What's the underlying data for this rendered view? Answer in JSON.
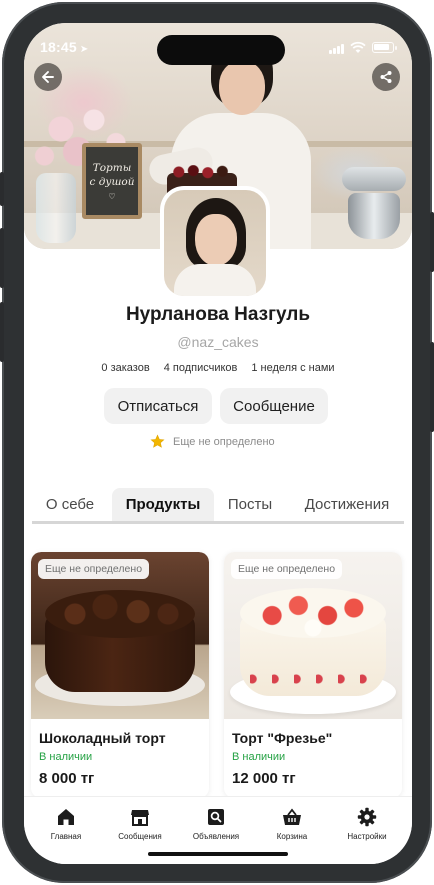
{
  "status": {
    "time": "18:45"
  },
  "hero": {
    "chalkboard_line1": "Торты",
    "chalkboard_line2": "с душой",
    "chalkboard_heart": "♡"
  },
  "profile": {
    "name": "Нурланова Назгуль",
    "handle": "@naz_cakes",
    "stats": {
      "orders": "0 заказов",
      "followers": "4 подписчиков",
      "since": "1 неделя с нами"
    },
    "unsubscribe_label": "Отписаться",
    "message_label": "Сообщение",
    "rating_text": "Еще не определено"
  },
  "tabs": [
    {
      "label": "О себе",
      "active": false
    },
    {
      "label": "Продукты",
      "active": true
    },
    {
      "label": "Посты",
      "active": false
    },
    {
      "label": "Достижения",
      "active": false
    }
  ],
  "products": [
    {
      "tag": "Еще не определено",
      "title": "Шоколадный торт",
      "availability": "В наличии",
      "price": "8 000 тг"
    },
    {
      "tag": "Еще не определено",
      "title": "Торт \"Фрезье\"",
      "availability": "В наличии",
      "price": "12 000 тг"
    }
  ],
  "nav": [
    {
      "label": "Главная",
      "icon": "home-icon"
    },
    {
      "label": "Сообщения",
      "icon": "store-icon"
    },
    {
      "label": "Объявления",
      "icon": "ads-search-icon"
    },
    {
      "label": "Корзина",
      "icon": "basket-icon"
    },
    {
      "label": "Настройки",
      "icon": "gear-icon"
    }
  ],
  "colors": {
    "available_green": "#25a244",
    "star": "#f2b600",
    "frame": "#2e3133"
  }
}
